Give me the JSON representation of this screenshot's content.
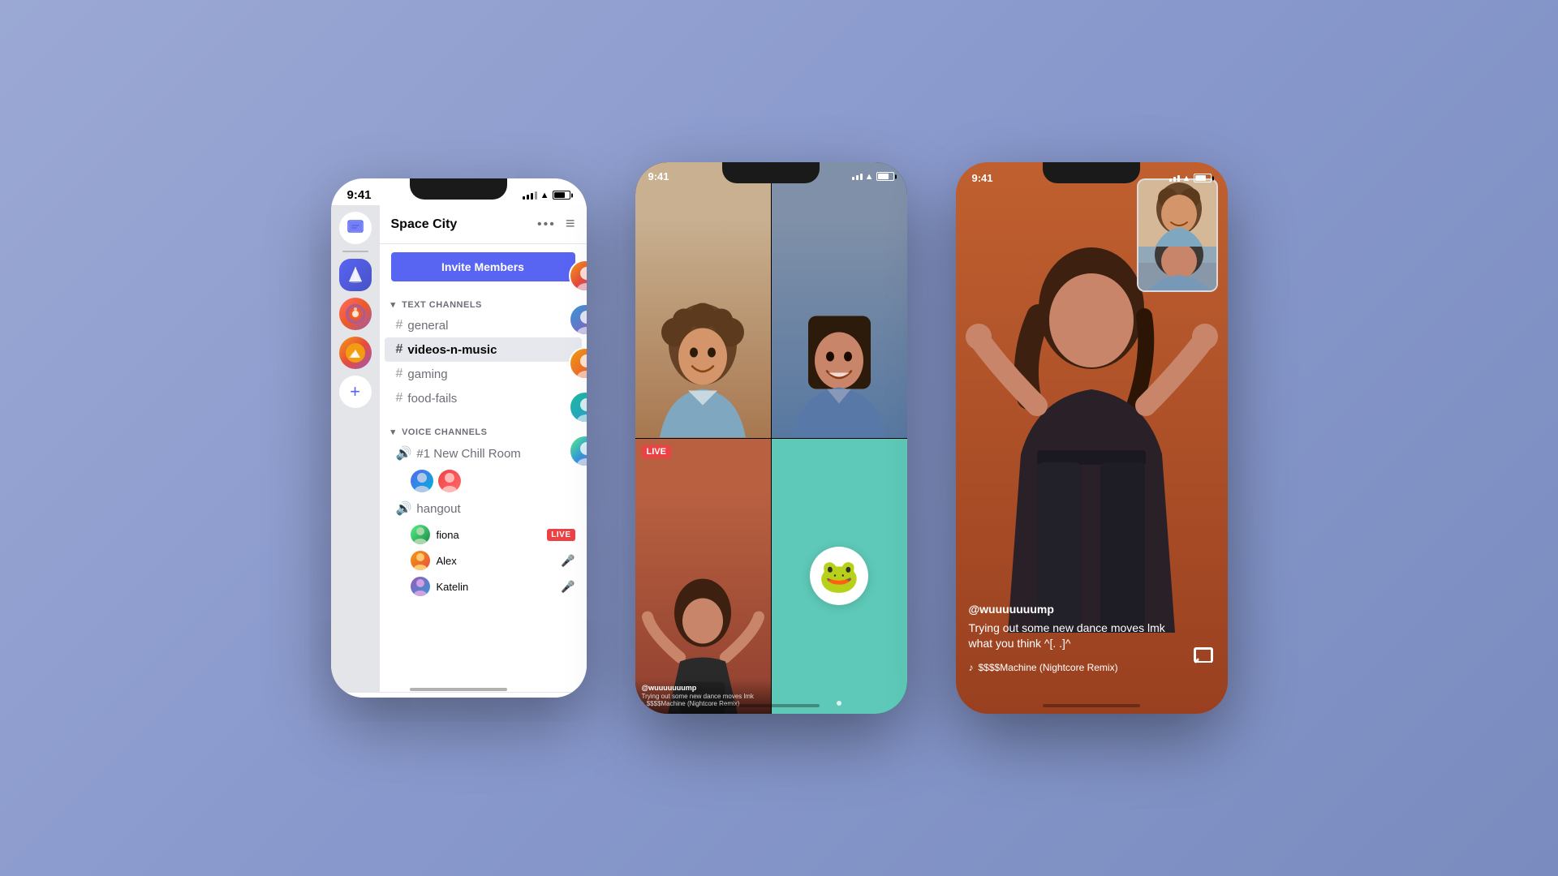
{
  "background": "#8898cc",
  "phone1": {
    "status_time": "9:41",
    "server_name": "Space City",
    "invite_label": "Invite Members",
    "text_channels_label": "TEXT CHANNELS",
    "voice_channels_label": "VOICE CHANNELS",
    "channels": [
      {
        "name": "general",
        "active": false
      },
      {
        "name": "videos-n-music",
        "active": true
      },
      {
        "name": "gaming",
        "active": false
      },
      {
        "name": "food-fails",
        "active": false
      }
    ],
    "voice_channels": [
      {
        "name": "#1 New Chill Room",
        "members": []
      },
      {
        "name": "hangout",
        "members": [
          {
            "name": "fiona",
            "live": true
          },
          {
            "name": "Alex",
            "live": false
          },
          {
            "name": "Katelin",
            "live": false
          }
        ]
      }
    ]
  },
  "phone2": {
    "status_time": "9:41",
    "live_label": "LIVE",
    "username": "@wuuuuuuump",
    "caption": "Trying out some new dance moves lmk what you think",
    "music": "$$$$Machine (Nightcore Remix)"
  },
  "phone3": {
    "status_time": "9:41",
    "username": "@wuuuuuuump",
    "caption": "Trying out some new dance moves lmk what you think ^[. .]^",
    "music": "$$$$Machine (Nightcore Remix)"
  }
}
